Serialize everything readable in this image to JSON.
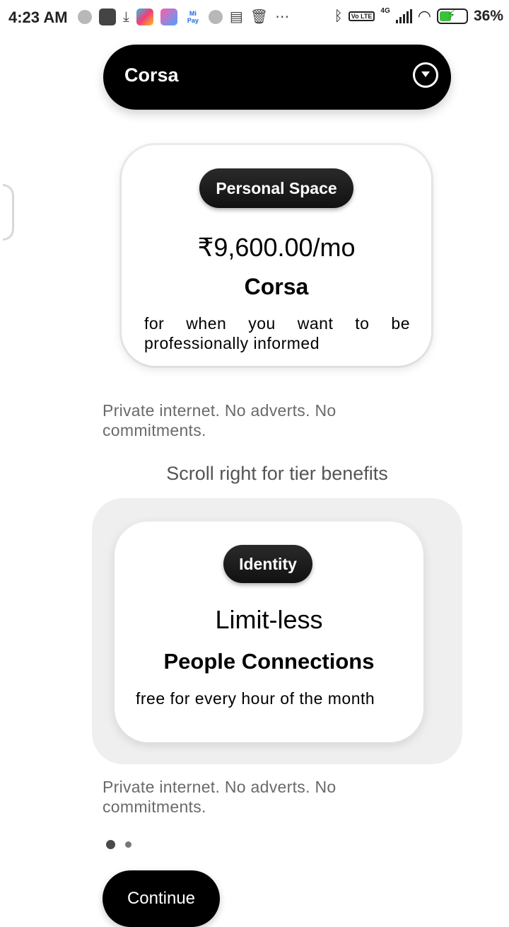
{
  "status_bar": {
    "time": "4:23 AM",
    "network": "4G",
    "lte": "Vo LTE",
    "battery": "36%",
    "icons": [
      "notification-dot-icon",
      "app-icon",
      "download-icon",
      "game-icon",
      "shortcut-icon",
      "mi-pay-icon",
      "notification-dot-icon",
      "calendar-icon",
      "trash-icon",
      "more-icon",
      "bluetooth-icon",
      "lte-icon",
      "signal-icon",
      "wifi-icon",
      "battery-icon"
    ]
  },
  "selector": {
    "value": "Corsa"
  },
  "plan_card": {
    "badge": "Personal Space",
    "price": "₹9,600.00/mo",
    "title": "Corsa",
    "description": "for when you want to be professionally informed"
  },
  "note_1": "Private internet. No adverts. No commitments.",
  "scroll_hint": "Scroll right for tier benefits",
  "benefit_card": {
    "badge": "Identity",
    "headline": "Limit-less",
    "title": "People Connections",
    "description": "free for every hour of the month"
  },
  "note_2": "Private internet. No adverts. No commitments.",
  "continue_label": "Continue",
  "colors": {
    "primary": "#000000",
    "muted_text": "#6a6a6a",
    "carousel_bg": "#efefef"
  }
}
